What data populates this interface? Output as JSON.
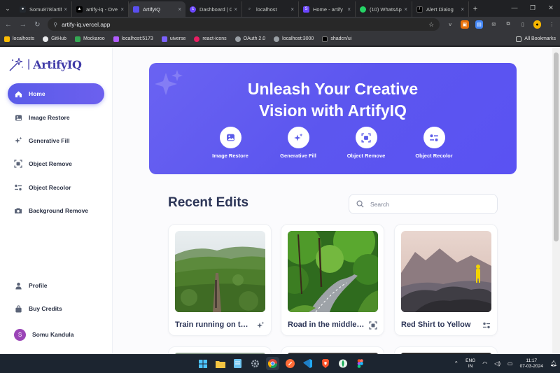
{
  "browser": {
    "tabs": [
      {
        "title": "Somu878/artif",
        "fav_color": "#24292f",
        "active": false
      },
      {
        "title": "artify-iq - Ove",
        "fav_color": "#000000",
        "active": false
      },
      {
        "title": "ArtifyIQ",
        "fav_color": "#5a4ff0",
        "active": true
      },
      {
        "title": "Dashboard | C",
        "fav_color": "#6c47ff",
        "active": false
      },
      {
        "title": "localhost",
        "fav_color": "#5f6368",
        "active": false
      },
      {
        "title": "Home - artify",
        "fav_color": "#6c47ff",
        "active": false
      },
      {
        "title": "(10) WhatsApp",
        "fav_color": "#25d366",
        "active": false
      },
      {
        "title": "Alert Dialog",
        "fav_color": "#000000",
        "active": false
      }
    ],
    "url": "artify-iq.vercel.app",
    "bookmarks": [
      {
        "label": "localhosts",
        "color": "#fbbc04"
      },
      {
        "label": "GitHub",
        "color": "#e8eaed"
      },
      {
        "label": "Mockaroo",
        "color": "#34a853"
      },
      {
        "label": "localhost:5173",
        "color": "#b05cff"
      },
      {
        "label": "uiverse",
        "color": "#7b61ff"
      },
      {
        "label": "react-icons",
        "color": "#e91e63"
      },
      {
        "label": "OAuth 2.0",
        "color": "#9aa0a6"
      },
      {
        "label": "localhost:3000",
        "color": "#9aa0a6"
      },
      {
        "label": "shadcn/ui",
        "color": "#000000"
      }
    ],
    "all_bookmarks": "All Bookmarks"
  },
  "app": {
    "name": "ArtifyIQ",
    "accent": "#5a5be9",
    "nav": [
      {
        "label": "Home",
        "icon": "home-icon",
        "active": true
      },
      {
        "label": "Image Restore",
        "icon": "image-icon",
        "active": false
      },
      {
        "label": "Generative Fill",
        "icon": "sparkles-icon",
        "active": false
      },
      {
        "label": "Object Remove",
        "icon": "scan-icon",
        "active": false
      },
      {
        "label": "Object Recolor",
        "icon": "filter-icon",
        "active": false
      },
      {
        "label": "Background Remove",
        "icon": "camera-icon",
        "active": false
      }
    ],
    "bottom_nav": [
      {
        "label": "Profile",
        "icon": "user-icon"
      },
      {
        "label": "Buy Credits",
        "icon": "bag-icon"
      }
    ],
    "user": {
      "name": "Somu Kandula",
      "initial": "S"
    },
    "hero": {
      "line1": "Unleash Your Creative",
      "line2": "Vision with ArtifyIQ",
      "tools": [
        {
          "label": "Image Restore",
          "icon": "image-icon"
        },
        {
          "label": "Generative Fill",
          "icon": "sparkles-icon"
        },
        {
          "label": "Object Remove",
          "icon": "scan-icon"
        },
        {
          "label": "Object Recolor",
          "icon": "filter-icon"
        }
      ]
    },
    "recent": {
      "title": "Recent Edits",
      "search_placeholder": "Search",
      "items": [
        {
          "caption": "Train running on the track",
          "icon": "sparkles-icon"
        },
        {
          "caption": "Road in the middle of forest",
          "icon": "scan-icon"
        },
        {
          "caption": "Red Shirt to Yellow",
          "icon": "filter-icon"
        }
      ]
    }
  },
  "taskbar": {
    "lang": "ENG",
    "region": "IN",
    "time": "11:17",
    "date": "07-03-2024"
  }
}
